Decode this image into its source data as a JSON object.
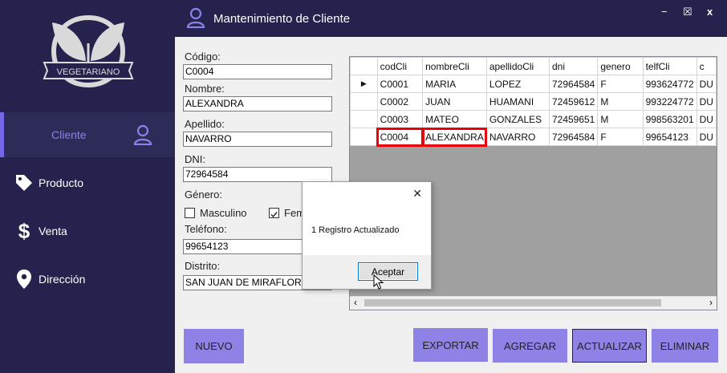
{
  "window": {
    "title": "Mantenimiento de Cliente",
    "controls": [
      "−",
      "☒",
      "x"
    ]
  },
  "logo": {
    "text": "VEGETARIANO"
  },
  "sidebar": {
    "items": [
      {
        "label": "Cliente",
        "icon": "user-icon",
        "active": true
      },
      {
        "label": "Producto",
        "icon": "tag-icon"
      },
      {
        "label": "Venta",
        "icon": "dollar-icon"
      },
      {
        "label": "Dirección",
        "icon": "location-pin-icon"
      }
    ]
  },
  "form": {
    "codigo_label": "Código:",
    "codigo_value": "C0004",
    "nombre_label": "Nombre:",
    "nombre_value": "ALEXANDRA",
    "apellido_label": "Apellido:",
    "apellido_value": "NAVARRO",
    "dni_label": "DNI:",
    "dni_value": "72964584",
    "genero_label": "Género:",
    "masculino_label": "Masculino",
    "femenino_label": "Fem",
    "telefono_label": "Teléfono:",
    "telefono_value": "99654123",
    "distrito_label": "Distrito:",
    "distrito_value": "SAN JUAN DE MIRAFLORE"
  },
  "grid": {
    "columns": [
      "codCli",
      "nombreCli",
      "apellidoCli",
      "dni",
      "genero",
      "telfCli",
      "c"
    ],
    "rows": [
      [
        "C0001",
        "MARIA",
        "LOPEZ",
        "72964584",
        "F",
        "993624772",
        "DU"
      ],
      [
        "C0002",
        "JUAN",
        "HUAMANI",
        "72459612",
        "M",
        "993224772",
        "DU"
      ],
      [
        "C0003",
        "MATEO",
        "GONZALES",
        "72459651",
        "M",
        "998563201",
        "DU"
      ],
      [
        "C0004",
        "ALEXANDRA",
        "NAVARRO",
        "72964584",
        "F",
        "99654123",
        "DU"
      ]
    ]
  },
  "dialog": {
    "message": "1 Registro Actualizado",
    "button": "Aceptar",
    "close": "✕"
  },
  "buttons": {
    "nuevo": "NUEVO",
    "exportar": "EXPORTAR",
    "agregar": "AGREGAR",
    "actualizar": "ACTUALIZAR",
    "eliminar": "ELIMINAR"
  },
  "colors": {
    "sidebar": "#25234d",
    "accent": "#8f82e6",
    "highlight": "#e8000b"
  }
}
